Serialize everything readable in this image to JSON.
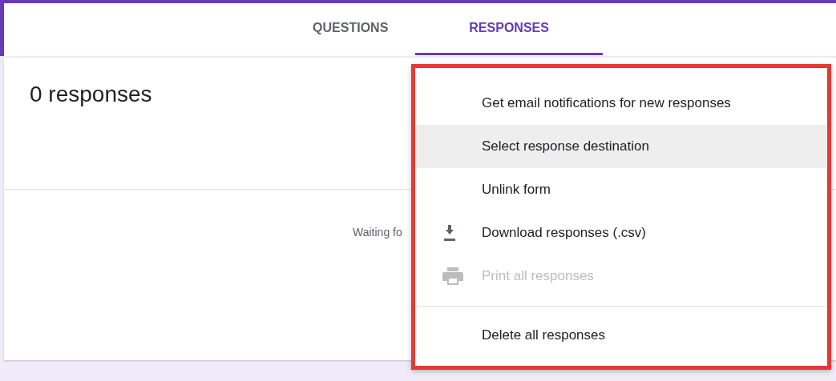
{
  "tabs": [
    {
      "label": "QUESTIONS",
      "selected": false
    },
    {
      "label": "RESPONSES",
      "selected": true
    }
  ],
  "summary": {
    "title": "0 responses",
    "status": "Waiting fo"
  },
  "menu": {
    "items": [
      {
        "label": "Get email notifications for new responses",
        "kind": "plain",
        "selected": false,
        "disabled": false
      },
      {
        "label": "Select response destination",
        "kind": "plain",
        "selected": true,
        "disabled": false
      },
      {
        "label": "Unlink form",
        "kind": "plain",
        "selected": false,
        "disabled": false
      },
      {
        "label": "Download responses (.csv)",
        "kind": "download",
        "selected": false,
        "disabled": false
      },
      {
        "label": "Print all responses",
        "kind": "print",
        "selected": false,
        "disabled": true
      },
      {
        "kind": "divider"
      },
      {
        "label": "Delete all responses",
        "kind": "plain",
        "selected": false,
        "disabled": false
      }
    ]
  }
}
